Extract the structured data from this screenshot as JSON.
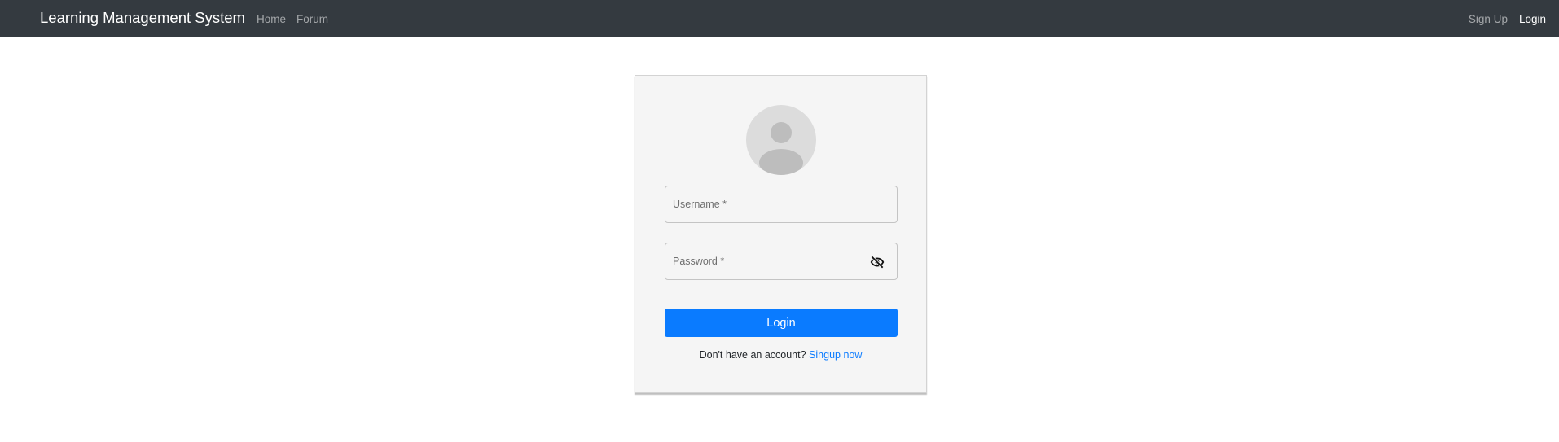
{
  "navbar": {
    "brand": "Learning Management System",
    "left_links": [
      {
        "label": "Home"
      },
      {
        "label": "Forum"
      }
    ],
    "right_links": [
      {
        "label": "Sign Up"
      },
      {
        "label": "Login"
      }
    ]
  },
  "login_form": {
    "avatar_icon": "user-avatar-icon",
    "username": {
      "placeholder": "Username *",
      "value": ""
    },
    "password": {
      "placeholder": "Password *",
      "value": "",
      "toggle_icon": "eye-off-icon"
    },
    "submit_label": "Login",
    "signup_prompt": "Don't have an account?",
    "signup_link": "Singup now"
  },
  "colors": {
    "navbar_bg": "#343a40",
    "primary": "#0a7bff",
    "card_bg": "#f5f5f5"
  }
}
